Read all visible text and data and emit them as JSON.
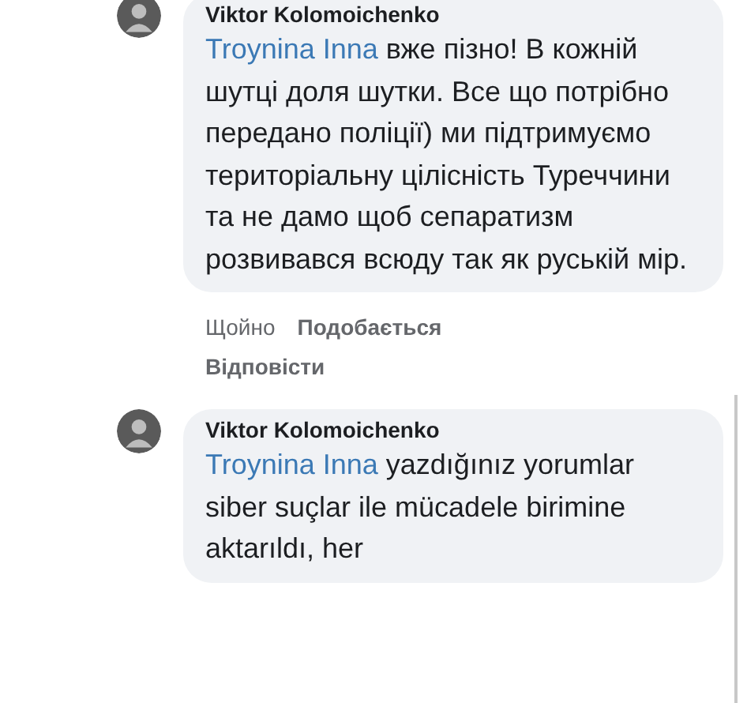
{
  "comments": [
    {
      "author": "Viktor Kolomoichenko",
      "mention": "Troynina Inna",
      "text": "вже пізно! В кожній шутці доля шутки. Все що потрібно передано поліції) ми підтримуємо територіальну цілісність Туреччини та не дамо щоб сепаратизм розвивався всюду так як руській мір.",
      "actions": [
        {
          "kind": "time",
          "label": "Щойно"
        },
        {
          "kind": "link",
          "label": "Подобається"
        },
        {
          "kind": "link",
          "label": "Відповісти"
        }
      ]
    },
    {
      "author": "Viktor Kolomoichenko",
      "mention": "Troynina Inna",
      "text": "yazdığınız yorumlar siber suçlar ile mücadele birimine aktarıldı, her"
    }
  ]
}
